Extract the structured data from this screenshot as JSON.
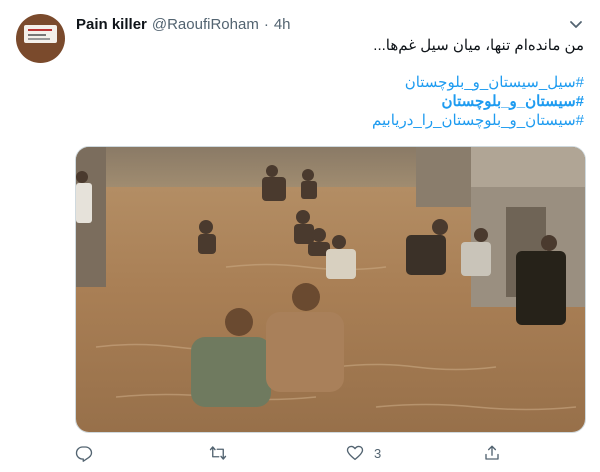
{
  "tweet": {
    "display_name": "Pain killer",
    "handle": "@RaoufiRoham",
    "separator": "·",
    "time": "4h",
    "text": "من مانده‌ام تنها، میان سیل غم‌ها...",
    "hashtags": [
      "#سیل_سیستان_و_بلوچستان",
      "#سیستان_و_بلوچستان",
      "#سیستان_و_بلوچستان_را_دریابیم"
    ],
    "media": {
      "description_icon": "flood-photo"
    },
    "actions": {
      "reply_count": "",
      "retweet_count": "",
      "like_count": "3",
      "share_count": ""
    }
  },
  "colors": {
    "accent": "#1d9bf0",
    "text": "#0f1419",
    "secondary": "#536471"
  }
}
